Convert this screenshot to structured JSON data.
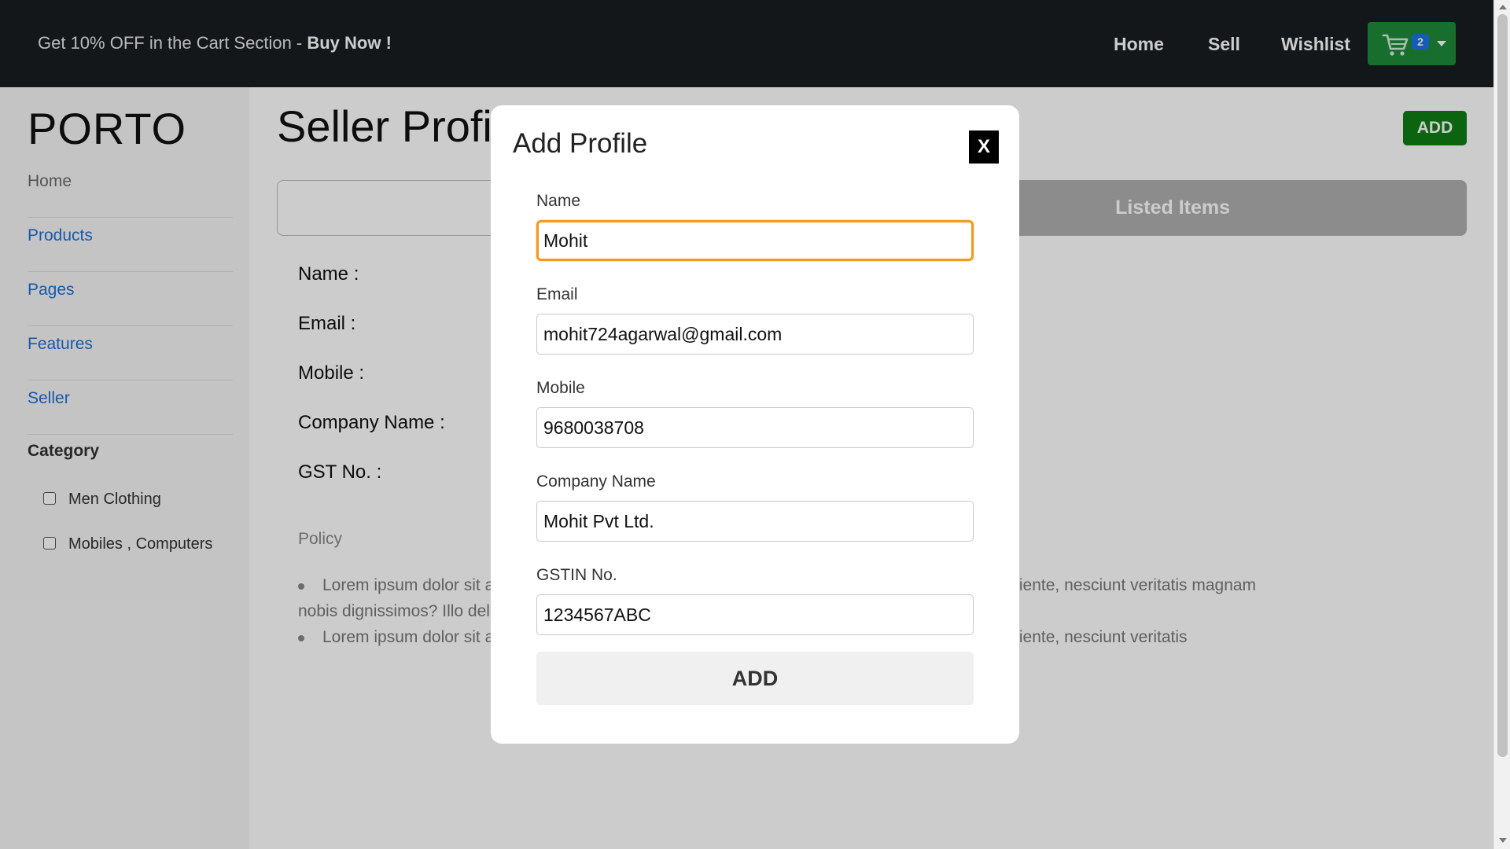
{
  "header": {
    "promo_text": "Get 10% OFF in the Cart Section - ",
    "promo_cta": "Buy Now !",
    "nav": [
      {
        "label": "Home"
      },
      {
        "label": "Sell"
      },
      {
        "label": "Wishlist"
      }
    ],
    "cart": {
      "icon": "cart-icon",
      "count": "2",
      "color": "#1f8b39",
      "badge_color": "#1d72e8"
    }
  },
  "sidebar": {
    "logo": "PORTO",
    "items": [
      {
        "label": "Home"
      },
      {
        "label": "Products"
      },
      {
        "label": "Pages"
      },
      {
        "label": "Features"
      },
      {
        "label": "Seller"
      }
    ],
    "category_title": "Category",
    "categories": [
      {
        "label": "Men Clothing",
        "checked": false
      },
      {
        "label": "Mobiles , Computers",
        "checked": false
      }
    ]
  },
  "main": {
    "title": "Seller Profile",
    "add_button": "ADD",
    "tabs": [
      {
        "label": ""
      },
      {
        "label": "Listed Items"
      }
    ],
    "fields": [
      {
        "label": "Name :"
      },
      {
        "label": "Email :"
      },
      {
        "label": "Mobile :"
      },
      {
        "label": "Company Name :"
      },
      {
        "label": "GST No. :"
      }
    ],
    "policy_title": "Policy",
    "policy_items": [
      {
        "line1": "Lorem ipsum dolor sit amet consectetur adipisicing elit. Quisquam, ipsam. Nihil assumenda sapiente, nesciunt veritatis magnam",
        "line2": "nobis dignissimos? Illo deleniti quo asperiores laboriosam perferendis? Dolor numquam eos."
      },
      {
        "line1": "Lorem ipsum dolor sit amet consectetur adipisicing elit. Quisquam, ipsam. Nihil assumenda sapiente, nesciunt veritatis"
      }
    ]
  },
  "modal": {
    "title": "Add Profile",
    "close_label": "X",
    "fields": [
      {
        "label": "Name",
        "value": "Mohit"
      },
      {
        "label": "Email",
        "value": "mohit724agarwal@gmail.com"
      },
      {
        "label": "Mobile",
        "value": "9680038708"
      },
      {
        "label": "Company Name",
        "value": "Mohit Pvt Ltd."
      },
      {
        "label": "GSTIN No.",
        "value": "1234567ABC"
      }
    ],
    "submit_label": "ADD",
    "focus_color": "#f59a1b"
  }
}
